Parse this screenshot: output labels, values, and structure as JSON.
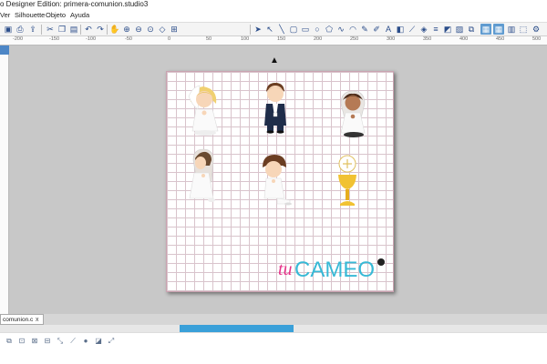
{
  "window": {
    "title": "o Designer Edition: primera-comunion.studio3"
  },
  "menu": [
    "Ver",
    "Silhouette",
    "Objeto",
    "Ayuda"
  ],
  "toolbar": {
    "left_icons": [
      "save-icon",
      "print-icon",
      "send-to-cutter-icon",
      "cut-icon",
      "copy-icon",
      "paste-icon",
      "undo-icon",
      "redo-icon",
      "pan-icon",
      "zoom-in-icon",
      "zoom-out-icon",
      "zoom-select-icon",
      "fit-page-icon",
      "fit-object-icon"
    ],
    "right_icons": [
      "pointer-icon",
      "edit-points-icon",
      "line-icon",
      "rectangle-icon",
      "rounded-rectangle-icon",
      "ellipse-icon",
      "polygon-icon",
      "curve-icon",
      "arc-icon",
      "freehand-icon",
      "smooth-freehand-icon",
      "text-icon",
      "eraser-icon",
      "knife-icon",
      "fill-icon",
      "line-style-icon",
      "shadow-icon",
      "image-icon",
      "replicate-icon",
      "align-icon",
      "grid-icon",
      "library-icon",
      "store-icon",
      "cut-settings-icon"
    ]
  },
  "ruler": {
    "labels": [
      "-200",
      "-150",
      "-100",
      "-50",
      "0",
      "50",
      "100",
      "150",
      "200",
      "250",
      "300",
      "350",
      "400",
      "450",
      "500"
    ]
  },
  "document": {
    "tab_label": "comunion.c",
    "close_symbol": "x"
  },
  "canvas": {
    "arrow_symbol": "▲"
  },
  "logo": {
    "part1": "tu",
    "part2": "CAMEO",
    "color1": "#e6338a",
    "color2": "#37b9d6"
  },
  "bottom_toolbar": {
    "icons": [
      "group-icon",
      "ungroup-icon",
      "compound-path-icon",
      "release-path-icon",
      "select-all-icon",
      "weld-icon",
      "offset-icon",
      "trace-icon",
      "transform-icon"
    ]
  },
  "colors": {
    "accent": "#3aa0d9",
    "grid": "#d9c4cc"
  }
}
